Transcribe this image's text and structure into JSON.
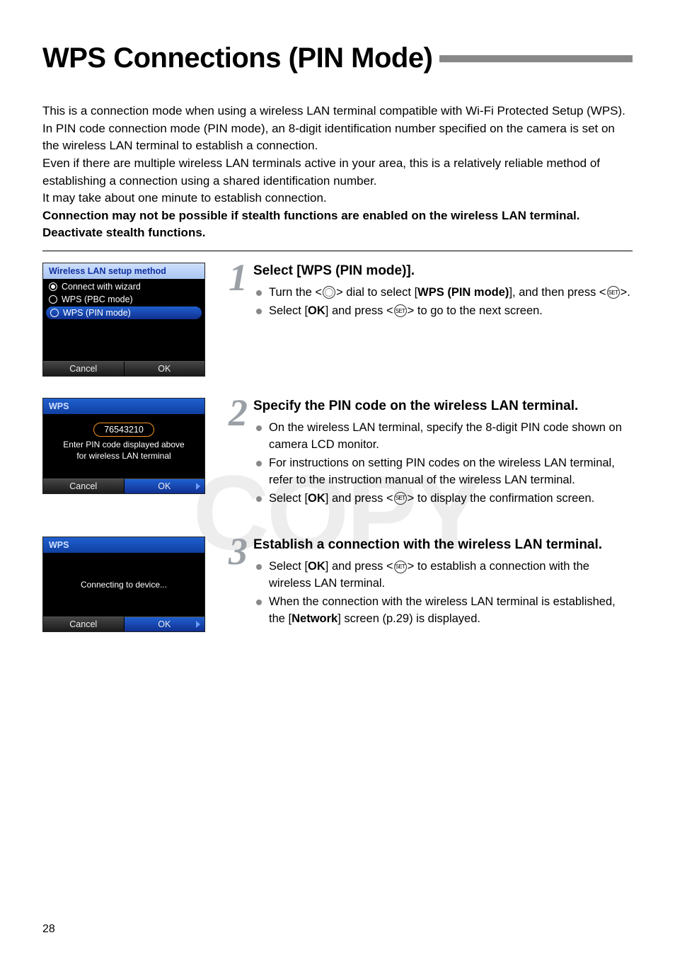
{
  "page": {
    "title": "WPS Connections (PIN Mode)",
    "number": "28",
    "watermark": "COPY"
  },
  "intro": {
    "p1": "This is a connection mode when using a wireless LAN terminal compatible with Wi-Fi Protected Setup (WPS). In PIN code connection mode (PIN mode), an 8-digit identification number specified on the camera is set on the wireless LAN terminal to establish a connection.",
    "p2": "Even if there are multiple wireless LAN terminals active in your area, this is a relatively reliable method of establishing a connection using a shared identification number.",
    "p3": "It may take about one minute to establish connection.",
    "p4_bold": "Connection may not be possible if stealth functions are enabled on the wireless LAN terminal. Deactivate stealth functions."
  },
  "lcd1": {
    "title": "Wireless LAN setup method",
    "opt1": "Connect with wizard",
    "opt2": "WPS (PBC mode)",
    "opt3": "WPS (PIN mode)",
    "cancel": "Cancel",
    "ok": "OK"
  },
  "lcd2": {
    "title": "WPS",
    "pin": "76543210",
    "line1": "Enter PIN code displayed above",
    "line2": "for wireless LAN terminal",
    "cancel": "Cancel",
    "ok": "OK"
  },
  "lcd3": {
    "title": "WPS",
    "msg": "Connecting to device...",
    "cancel": "Cancel",
    "ok": "OK"
  },
  "step1": {
    "num": "1",
    "title": "Select [WPS (PIN mode)].",
    "b1a": "Turn the <",
    "b1b": "> dial to select [",
    "b1_bold": "WPS (PIN mode)",
    "b1c": "], and then press <",
    "b1d": ">.",
    "b2a": "Select [",
    "b2_ok": "OK",
    "b2b": "] and press <",
    "b2c": "> to go to the next screen."
  },
  "step2": {
    "num": "2",
    "title": "Specify the PIN code on the wireless LAN terminal.",
    "b1": "On the wireless LAN terminal, specify the 8-digit PIN code shown on camera LCD monitor.",
    "b2": "For instructions on setting PIN codes on the wireless LAN terminal, refer to the instruction manual of the wireless LAN terminal.",
    "b3a": "Select [",
    "b3_ok": "OK",
    "b3b": "] and press <",
    "b3c": "> to display the confirmation screen."
  },
  "step3": {
    "num": "3",
    "title": "Establish a connection with the wireless LAN terminal.",
    "b1a": "Select [",
    "b1_ok": "OK",
    "b1b": "] and press <",
    "b1c": "> to establish a connection with the wireless LAN terminal.",
    "b2a": "When the connection with the wireless LAN terminal is established, the [",
    "b2_bold": "Network",
    "b2b": "] screen (p.29) is displayed."
  },
  "icons": {
    "set": "SET"
  }
}
